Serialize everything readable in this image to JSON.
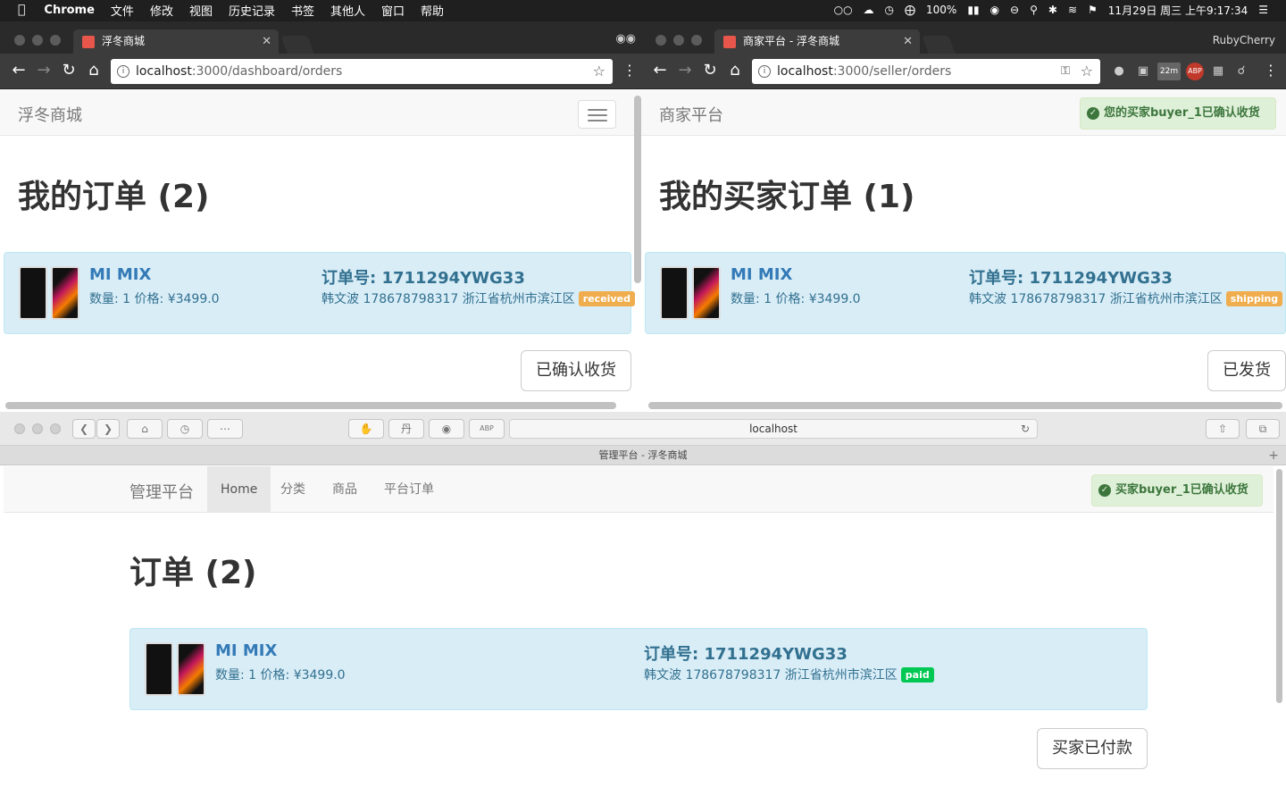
{
  "menubar": {
    "apple": "",
    "app_name": "Chrome",
    "items": [
      "文件",
      "修改",
      "视图",
      "历史记录",
      "书签",
      "其他人",
      "窗口",
      "帮助"
    ],
    "battery": "100%",
    "datetime": "11月29日 周三 上午9:17:34"
  },
  "win1": {
    "tab_title": "浮冬商城",
    "url_host": "localhost",
    "url_path": ":3000/dashboard/orders",
    "brand": "浮冬商城",
    "heading": "我的订单 (2)",
    "order": {
      "product": "MI MIX",
      "meta": "数量: 1 价格: ¥3499.0",
      "order_no": "订单号: 1711294YWG33",
      "address": "韩文波 178678798317 浙江省杭州市滨江区",
      "status": "received",
      "status_color": "#f0ad4e"
    },
    "action": "已确认收货"
  },
  "win2": {
    "tab_title": "商家平台 - 浮冬商城",
    "profile": "RubyCherry",
    "url_host": "localhost",
    "url_path": ":3000/seller/orders",
    "ext_badge": "22m",
    "brand": "商家平台",
    "alert": "您的买家buyer_1已确认收货",
    "heading": "我的买家订单 (1)",
    "order": {
      "product": "MI MIX",
      "meta": "数量: 1 价格: ¥3499.0",
      "order_no": "订单号: 1711294YWG33",
      "address": "韩文波 178678798317 浙江省杭州市滨江区",
      "status": "shipping",
      "status_color": "#f0ad4e"
    },
    "action": "已发货"
  },
  "safari": {
    "address": "localhost",
    "tab_title": "管理平台 - 浮冬商城",
    "brand": "管理平台",
    "nav": [
      "Home",
      "分类",
      "商品",
      "平台订单"
    ],
    "alert": "买家buyer_1已确认收货",
    "heading": "订单 (2)",
    "order": {
      "product": "MI MIX",
      "meta": "数量: 1 价格: ¥3499.0",
      "order_no": "订单号: 1711294YWG33",
      "address": "韩文波 178678798317 浙江省杭州市滨江区",
      "status": "paid",
      "status_color": "#00c853"
    },
    "action": "买家已付款"
  }
}
